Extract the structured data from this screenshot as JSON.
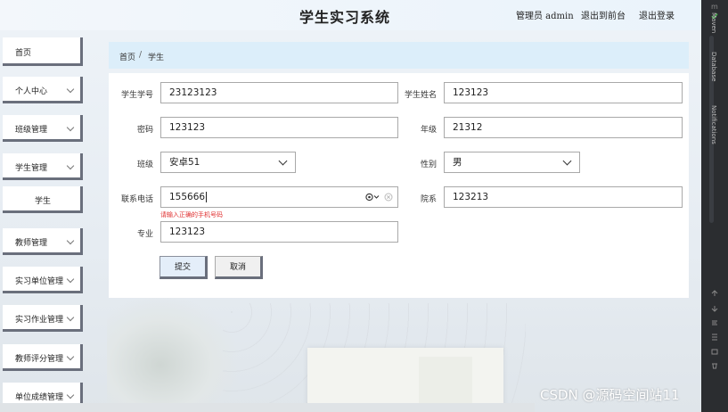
{
  "header": {
    "title": "学生实习系统",
    "user": "管理员 admin",
    "link_front": "退出到前台",
    "link_logout": "退出登录"
  },
  "sidebar": {
    "items": [
      {
        "label": "首页",
        "has_arrow": false
      },
      {
        "label": "个人中心",
        "has_arrow": true
      },
      {
        "label": "班级管理",
        "has_arrow": true
      },
      {
        "label": "学生管理",
        "has_arrow": true
      },
      {
        "label": "学生",
        "has_arrow": false,
        "sub": true
      },
      {
        "label": "教师管理",
        "has_arrow": true
      },
      {
        "label": "实习单位管理",
        "has_arrow": true
      },
      {
        "label": "实习作业管理",
        "has_arrow": true
      },
      {
        "label": "教师评分管理",
        "has_arrow": true
      },
      {
        "label": "单位成绩管理",
        "has_arrow": true
      }
    ]
  },
  "breadcrumb": {
    "home": "首页",
    "separator": "/",
    "current": "学生"
  },
  "form": {
    "student_no": {
      "label": "学生学号",
      "value": "23123123"
    },
    "student_name": {
      "label": "学生姓名",
      "value": "123123"
    },
    "password": {
      "label": "密码",
      "value": "123123"
    },
    "grade": {
      "label": "年级",
      "value": "21312"
    },
    "class": {
      "label": "班级",
      "value": "安卓51"
    },
    "gender": {
      "label": "性别",
      "value": "男"
    },
    "phone": {
      "label": "联系电话",
      "value": "155666",
      "error": "请输入正确的手机号码"
    },
    "department": {
      "label": "院系",
      "value": "123213"
    },
    "major": {
      "label": "专业",
      "value": "123123"
    },
    "submit_label": "提交",
    "cancel_label": "取消"
  },
  "ide": {
    "panel_maven": "Maven",
    "panel_database": "Database",
    "panel_notifications": "Notifications"
  },
  "watermark": "CSDN @源码空间站11"
}
